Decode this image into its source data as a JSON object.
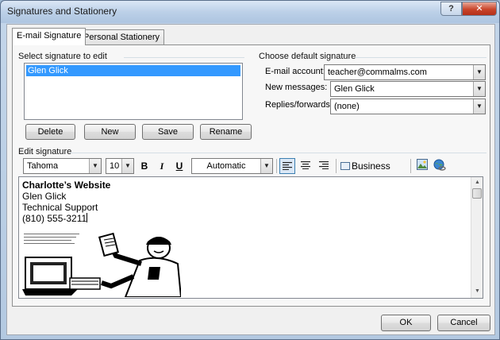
{
  "window": {
    "title": "Signatures and Stationery",
    "help_label": "?",
    "close_label": "✕"
  },
  "tabs": [
    {
      "label": "E-mail Signature"
    },
    {
      "label": "Personal Stationery"
    }
  ],
  "select_signature": {
    "label": "Select signature to edit",
    "items": [
      "Glen Glick"
    ],
    "buttons": {
      "delete": "Delete",
      "new": "New",
      "save": "Save",
      "rename": "Rename"
    }
  },
  "default_signature": {
    "label": "Choose default signature",
    "email_account_label": "E-mail account:",
    "email_account_value": "teacher@commalms.com",
    "new_messages_label": "New messages:",
    "new_messages_value": "Glen Glick",
    "replies_label": "Replies/forwards:",
    "replies_value": "(none)"
  },
  "edit_signature": {
    "label": "Edit signature",
    "font": "Tahoma",
    "size": "10",
    "bold_label": "B",
    "italic_label": "I",
    "underline_label": "U",
    "color": "Automatic",
    "business_card_label": "Business Card",
    "content": {
      "line1": "Charlotte’s Website",
      "line2": "Glen Glick",
      "line3": "Technical Support",
      "line4": "(810) 555-3211"
    }
  },
  "footer": {
    "ok": "OK",
    "cancel": "Cancel"
  },
  "colors": {
    "selection": "#3399ff",
    "title_bar": "#bcd0e8",
    "close_red": "#c9452b"
  },
  "icons": [
    "dropdown-arrow-icon",
    "align-left-icon",
    "align-center-icon",
    "align-right-icon",
    "business-card-icon",
    "insert-picture-icon",
    "insert-hyperlink-icon"
  ]
}
